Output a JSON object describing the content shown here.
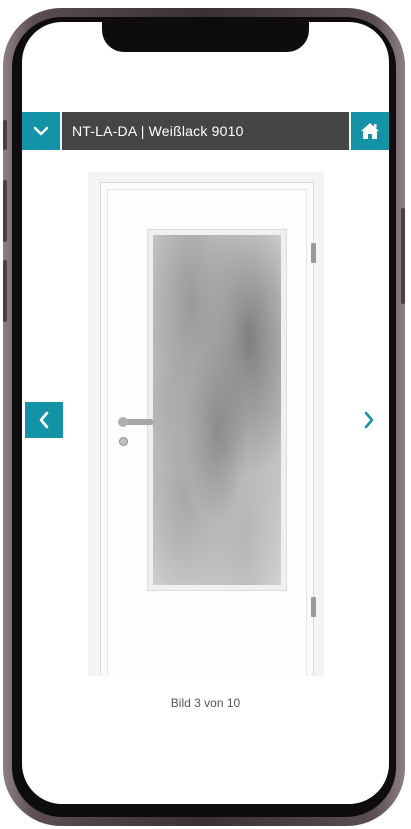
{
  "colors": {
    "accent": "#1593a6",
    "topbar": "#454545"
  },
  "header": {
    "menu_icon": "chevron-down-icon",
    "title": "NT-LA-DA | Weißlack 9010",
    "home_icon": "home-icon"
  },
  "gallery": {
    "prev_icon": "chevron-left-icon",
    "next_icon": "chevron-right-icon",
    "caption": "Bild 3 von 10"
  }
}
